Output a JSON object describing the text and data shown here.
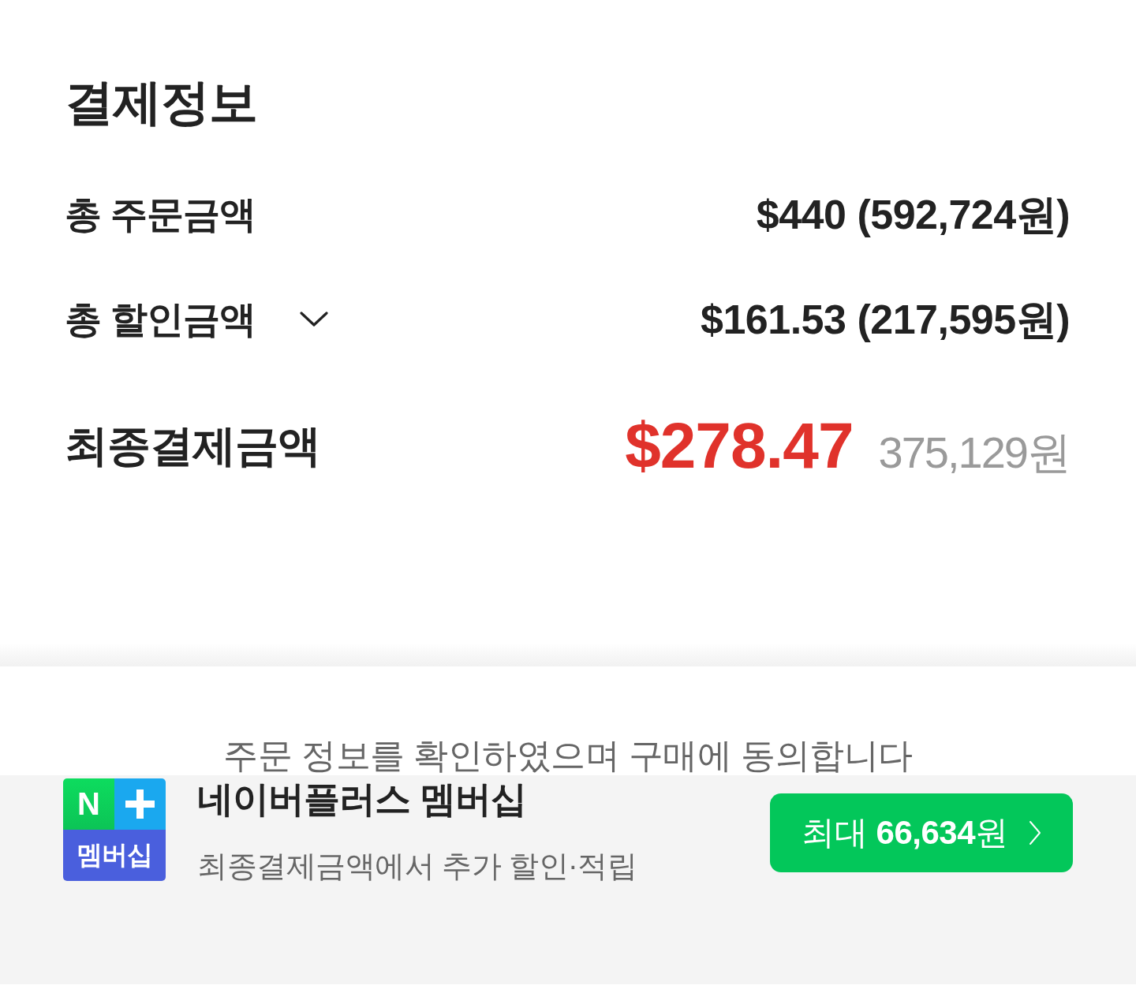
{
  "payment_info": {
    "title": "결제정보",
    "rows": [
      {
        "kind": "plain",
        "label": "총 주문금액",
        "value": "$440 (592,724원)"
      },
      {
        "kind": "expandable",
        "label": "총 할인금액",
        "expanded": false,
        "value": "$161.53 (217,595원)"
      }
    ],
    "final": {
      "label": "최종결제금액",
      "amount": "$278.47",
      "amount_krw": "375,129원"
    }
  },
  "agreement_note": "주문 정보를 확인하였으며 구매에 동의합니다",
  "membership": {
    "badge": {
      "letter": "N",
      "caption": "멤버십"
    },
    "title": "네이버플러스 멤버십",
    "subtitle": "최종결제금액에서 추가 할인·적립",
    "button": "최대 **66,634**원"
  }
}
